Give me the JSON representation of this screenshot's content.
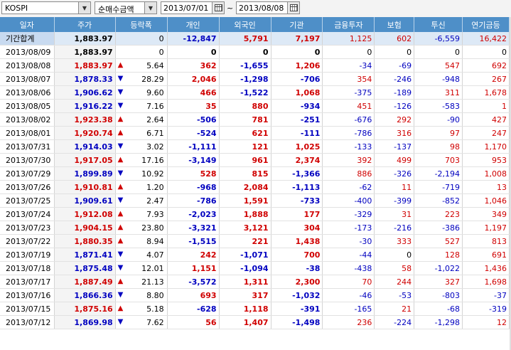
{
  "toolbar": {
    "market": "KOSPI",
    "mode": "순매수금액",
    "start_date": "2013/07/01",
    "separator": "~",
    "end_date": "2013/08/08"
  },
  "columns": [
    "일자",
    "주가",
    "등락폭",
    "개인",
    "외국인",
    "기관",
    "금융투자",
    "보험",
    "투신",
    "연기금등"
  ],
  "colors": {
    "up": "#d00000",
    "down": "#0000c0",
    "header": "#4e8fc8"
  },
  "rows": [
    {
      "date": "기간합계",
      "price": "1,883.97",
      "dir": "",
      "change": "0",
      "indiv": "-12,847",
      "foreign": "5,791",
      "inst": "7,197",
      "fin": "1,125",
      "ins": "602",
      "trust": "-6,559",
      "pension": "16,422"
    },
    {
      "date": "2013/08/09",
      "price": "1,883.97",
      "dir": "",
      "change": "0",
      "indiv": "0",
      "foreign": "0",
      "inst": "0",
      "fin": "0",
      "ins": "0",
      "trust": "0",
      "pension": "0"
    },
    {
      "date": "2013/08/08",
      "price": "1,883.97",
      "dir": "up",
      "change": "5.64",
      "indiv": "362",
      "foreign": "-1,655",
      "inst": "1,206",
      "fin": "-34",
      "ins": "-69",
      "trust": "547",
      "pension": "692"
    },
    {
      "date": "2013/08/07",
      "price": "1,878.33",
      "dir": "down",
      "change": "28.29",
      "indiv": "2,046",
      "foreign": "-1,298",
      "inst": "-706",
      "fin": "354",
      "ins": "-246",
      "trust": "-948",
      "pension": "267"
    },
    {
      "date": "2013/08/06",
      "price": "1,906.62",
      "dir": "down",
      "change": "9.60",
      "indiv": "466",
      "foreign": "-1,522",
      "inst": "1,068",
      "fin": "-375",
      "ins": "-189",
      "trust": "311",
      "pension": "1,678"
    },
    {
      "date": "2013/08/05",
      "price": "1,916.22",
      "dir": "down",
      "change": "7.16",
      "indiv": "35",
      "foreign": "880",
      "inst": "-934",
      "fin": "451",
      "ins": "-126",
      "trust": "-583",
      "pension": "1"
    },
    {
      "date": "2013/08/02",
      "price": "1,923.38",
      "dir": "up",
      "change": "2.64",
      "indiv": "-506",
      "foreign": "781",
      "inst": "-251",
      "fin": "-676",
      "ins": "292",
      "trust": "-90",
      "pension": "427"
    },
    {
      "date": "2013/08/01",
      "price": "1,920.74",
      "dir": "up",
      "change": "6.71",
      "indiv": "-524",
      "foreign": "621",
      "inst": "-111",
      "fin": "-786",
      "ins": "316",
      "trust": "97",
      "pension": "247"
    },
    {
      "date": "2013/07/31",
      "price": "1,914.03",
      "dir": "down",
      "change": "3.02",
      "indiv": "-1,111",
      "foreign": "121",
      "inst": "1,025",
      "fin": "-133",
      "ins": "-137",
      "trust": "98",
      "pension": "1,170"
    },
    {
      "date": "2013/07/30",
      "price": "1,917.05",
      "dir": "up",
      "change": "17.16",
      "indiv": "-3,149",
      "foreign": "961",
      "inst": "2,374",
      "fin": "392",
      "ins": "499",
      "trust": "703",
      "pension": "953"
    },
    {
      "date": "2013/07/29",
      "price": "1,899.89",
      "dir": "down",
      "change": "10.92",
      "indiv": "528",
      "foreign": "815",
      "inst": "-1,366",
      "fin": "886",
      "ins": "-326",
      "trust": "-2,194",
      "pension": "1,008"
    },
    {
      "date": "2013/07/26",
      "price": "1,910.81",
      "dir": "up",
      "change": "1.20",
      "indiv": "-968",
      "foreign": "2,084",
      "inst": "-1,113",
      "fin": "-62",
      "ins": "11",
      "trust": "-719",
      "pension": "13"
    },
    {
      "date": "2013/07/25",
      "price": "1,909.61",
      "dir": "down",
      "change": "2.47",
      "indiv": "-786",
      "foreign": "1,591",
      "inst": "-733",
      "fin": "-400",
      "ins": "-399",
      "trust": "-852",
      "pension": "1,046"
    },
    {
      "date": "2013/07/24",
      "price": "1,912.08",
      "dir": "up",
      "change": "7.93",
      "indiv": "-2,023",
      "foreign": "1,888",
      "inst": "177",
      "fin": "-329",
      "ins": "31",
      "trust": "223",
      "pension": "349"
    },
    {
      "date": "2013/07/23",
      "price": "1,904.15",
      "dir": "up",
      "change": "23.80",
      "indiv": "-3,321",
      "foreign": "3,121",
      "inst": "304",
      "fin": "-173",
      "ins": "-216",
      "trust": "-386",
      "pension": "1,197"
    },
    {
      "date": "2013/07/22",
      "price": "1,880.35",
      "dir": "up",
      "change": "8.94",
      "indiv": "-1,515",
      "foreign": "221",
      "inst": "1,438",
      "fin": "-30",
      "ins": "333",
      "trust": "527",
      "pension": "813"
    },
    {
      "date": "2013/07/19",
      "price": "1,871.41",
      "dir": "down",
      "change": "4.07",
      "indiv": "242",
      "foreign": "-1,071",
      "inst": "700",
      "fin": "-44",
      "ins": "0",
      "trust": "128",
      "pension": "691"
    },
    {
      "date": "2013/07/18",
      "price": "1,875.48",
      "dir": "down",
      "change": "12.01",
      "indiv": "1,151",
      "foreign": "-1,094",
      "inst": "-38",
      "fin": "-438",
      "ins": "58",
      "trust": "-1,022",
      "pension": "1,436"
    },
    {
      "date": "2013/07/17",
      "price": "1,887.49",
      "dir": "up",
      "change": "21.13",
      "indiv": "-3,572",
      "foreign": "1,311",
      "inst": "2,300",
      "fin": "70",
      "ins": "244",
      "trust": "327",
      "pension": "1,698"
    },
    {
      "date": "2013/07/16",
      "price": "1,866.36",
      "dir": "down",
      "change": "8.80",
      "indiv": "693",
      "foreign": "317",
      "inst": "-1,032",
      "fin": "-46",
      "ins": "-53",
      "trust": "-803",
      "pension": "-37"
    },
    {
      "date": "2013/07/15",
      "price": "1,875.16",
      "dir": "up",
      "change": "5.18",
      "indiv": "-628",
      "foreign": "1,118",
      "inst": "-391",
      "fin": "-165",
      "ins": "21",
      "trust": "-68",
      "pension": "-319"
    },
    {
      "date": "2013/07/12",
      "price": "1,869.98",
      "dir": "down",
      "change": "7.62",
      "indiv": "56",
      "foreign": "1,407",
      "inst": "-1,498",
      "fin": "236",
      "ins": "-224",
      "trust": "-1,298",
      "pension": "12"
    }
  ]
}
